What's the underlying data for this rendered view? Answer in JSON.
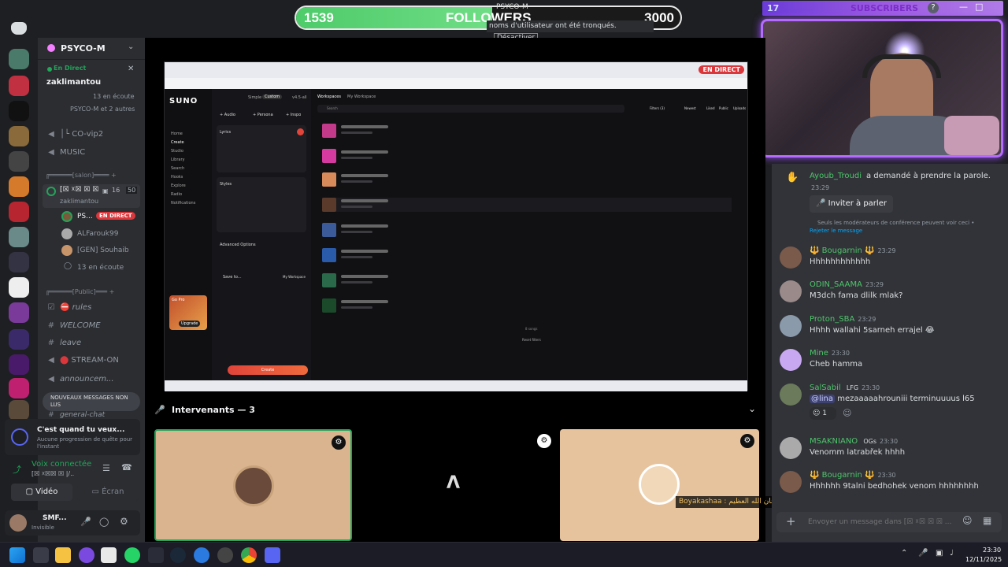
{
  "overlay": {
    "followers_count": "1539",
    "followers_label": "FOLLOWERS",
    "followers_goal": "3000",
    "subscribers_count": "17",
    "subscribers_label": "SUBSCRIBERS",
    "stream_title": "PSYCO-M",
    "notice_text": "noms d'utilisateur ont été tronqués.",
    "notice_button": "Désactiver",
    "chat_banner": "Boyakashaa : سبحان الله العظيم 🌸 سبحان الله العظيم 🌸"
  },
  "server": {
    "name": "PSYCO-M",
    "live_label": "En Direct",
    "live_user": "zaklimantou",
    "listeners": "13 en écoute",
    "live_others": "PSYCO-M et 2 autres"
  },
  "channels": {
    "vip": "│└ CO-vip2",
    "music": "MUSIC",
    "category_salon": "╔══════[salon]════",
    "voice_channel": "[☒ ☓☒ ☒ ☒",
    "voice_count_a": "16",
    "voice_count_b": "50",
    "voice_owner": "zaklimantou",
    "member1": "PS...",
    "member1_badge": "EN DIRECT",
    "member2": "ALFarouk99",
    "member3": "[GEN] Souhaib",
    "listening": "13 en écoute",
    "category_public": "╔══════[Public]═══",
    "rules": "rules",
    "welcome": "WELCOME",
    "leave": "leave",
    "stream_on": "STREAM-ON",
    "announcement": "announcem...",
    "general_chat": "general-chat",
    "new_messages": "NOUVEAUX MESSAGES NON LUS"
  },
  "quest": {
    "title": "C'est quand tu veux...",
    "subtitle": "Aucune progression de quête pour l'instant"
  },
  "voice": {
    "status": "Voix connectée",
    "channel": "[☒ ☓☒☒ ☒ |/..",
    "video_label": "Vidéo",
    "screen_label": "Écran"
  },
  "user": {
    "name": "SMF...",
    "status": "Invisible"
  },
  "stage": {
    "speakers_label": "Intervenants — 3",
    "live_badge": "EN DIRECT"
  },
  "suno": {
    "logo": "SUNO",
    "tab_simple": "Simple",
    "tab_custom": "Custom",
    "version": "v4.5-all",
    "workspaces": "Workspaces",
    "my_workspace": "My Workspace",
    "search": "Search",
    "audio": "+ Audio",
    "persona": "+ Persona",
    "inspo": "+ Inspo",
    "lyrics": "Lyrics",
    "styles": "Styles",
    "advanced": "Advanced Options",
    "save_to": "Save to...",
    "create_button": "Create",
    "go_pro": "Go Pro",
    "upgrade": "Upgrade",
    "nav": [
      "Home",
      "Create",
      "Studio",
      "Library",
      "Search",
      "Hooks",
      "Explore",
      "Radio",
      "Notifications"
    ],
    "songs_count": "8 songs",
    "reset": "Reset filters",
    "filters": "Filters (3)",
    "newest": "Newest",
    "liked": "Liked",
    "public": "Public",
    "uploads": "Uploads"
  },
  "chat": {
    "request_user": "Ayoub_Troudi",
    "request_text": "a demandé à prendre la parole.",
    "request_time": "23:29",
    "invite_button": "Inviter à parler",
    "moderator_note": "Seuls les modérateurs de conférence peuvent voir ceci •",
    "reject_link": "Rejeter le message",
    "input_placeholder": "Envoyer un message dans [☒ ☓☒ ☒ ☒ ...",
    "messages": [
      {
        "user": "🔱 Bougarnin 🔱",
        "time": "23:29",
        "text": "Hhhhhhhhhhhh",
        "color": "#4ec56a"
      },
      {
        "user": "ODIN_SAAMA",
        "time": "23:29",
        "text": "M3dch fama dlilk mlak?",
        "color": "#4ec56a"
      },
      {
        "user": "Proton_SBA",
        "time": "23:29",
        "text": "Hhhh wallahi 5sarneh errajel 😂",
        "color": "#4ec56a"
      },
      {
        "user": "Mine",
        "time": "23:30",
        "text": "Cheb hamma",
        "color": "#4ec56a"
      },
      {
        "user": "SalSabil",
        "tag": "LFG",
        "time": "23:30",
        "text": "mezaaaaahrouniii terminuuuus l65",
        "mention": "@lina",
        "reaction_count": "1",
        "color": "#4ec56a"
      },
      {
        "user": "MSAKNIANO",
        "tag": "OGs",
        "time": "23:30",
        "text": "Venomm latrabřek hhhh",
        "color": "#4ec56a"
      },
      {
        "user": "🔱 Bougarnin 🔱",
        "time": "23:30",
        "text": "Hhhhhh 9talni bedhohek venom hhhhhhhh",
        "color": "#4ec56a"
      }
    ]
  },
  "taskbar": {
    "time": "23:30",
    "date": "12/11/2025"
  },
  "colors": {
    "live_red": "#da373c",
    "discord_green": "#23a55a",
    "tile_bg": "#d9b48f",
    "accent_purple": "#a349ff"
  }
}
